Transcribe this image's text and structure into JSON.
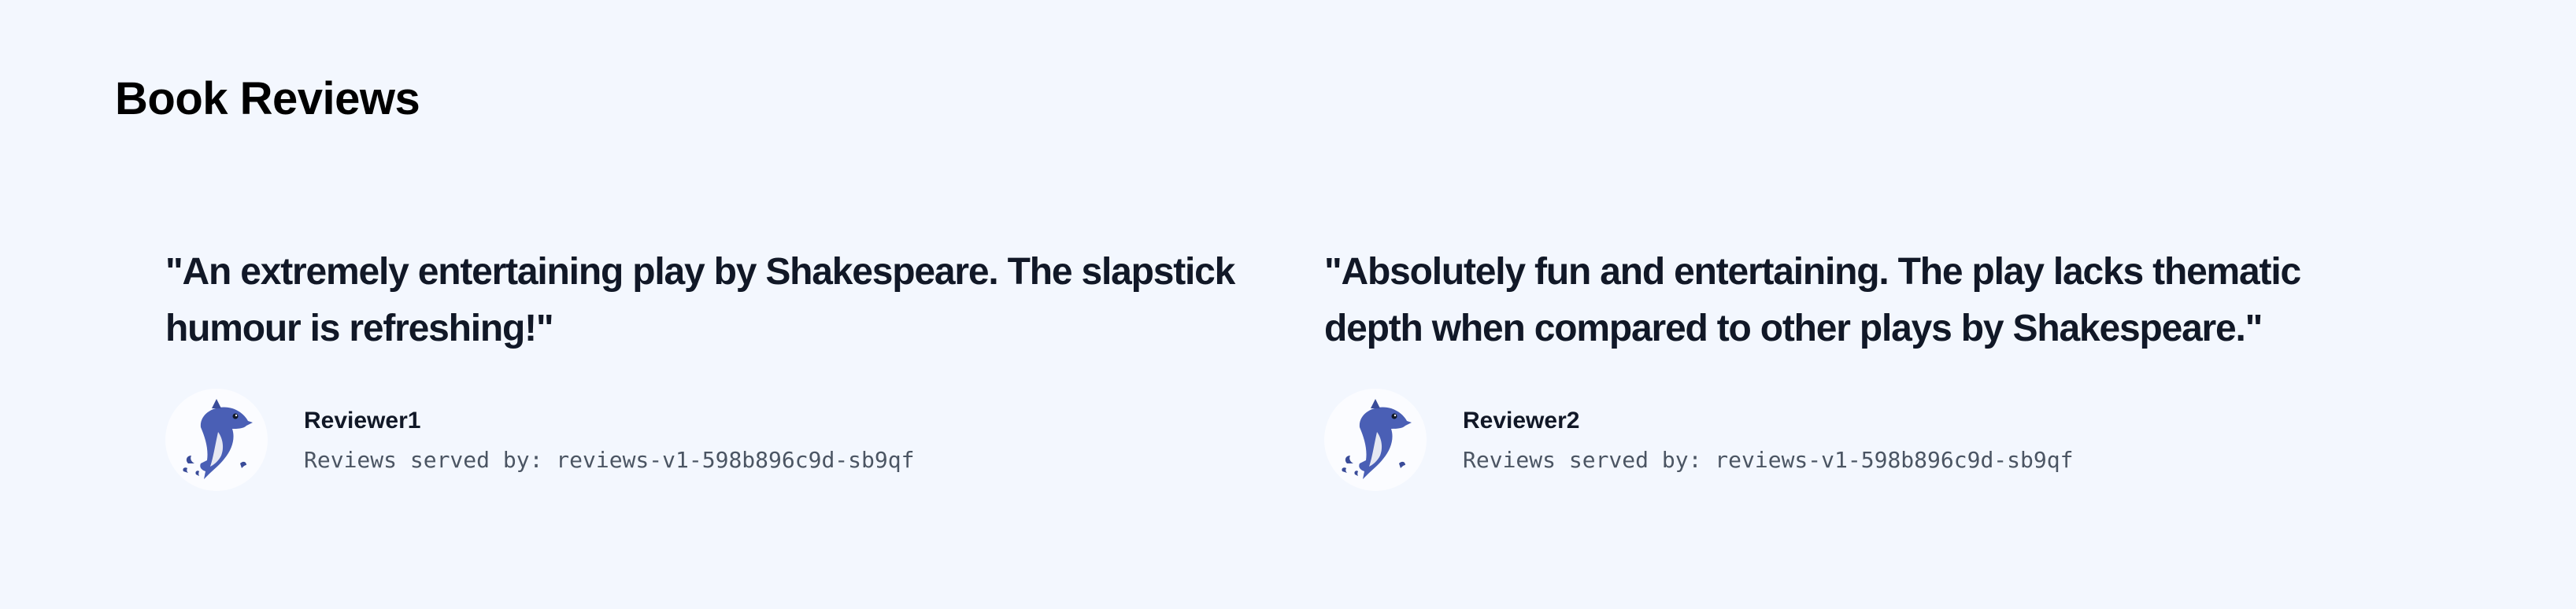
{
  "page": {
    "title": "Book Reviews"
  },
  "reviews": [
    {
      "text": "\"An extremely entertaining play by Shakespeare. The slapstick humour is refreshing!\"",
      "reviewer": "Reviewer1",
      "avatar_icon": "dolphin-icon",
      "served_by": "Reviews served by: reviews-v1-598b896c9d-sb9qf"
    },
    {
      "text": "\"Absolutely fun and entertaining. The play lacks thematic depth when compared to other plays by Shakespeare.\"",
      "reviewer": "Reviewer2",
      "avatar_icon": "dolphin-icon",
      "served_by": "Reviews served by: reviews-v1-598b896c9d-sb9qf"
    }
  ],
  "colors": {
    "background": "#f3f7fe",
    "text_primary": "#111827",
    "text_secondary": "#4b5563",
    "dolphin_blue": "#4a5fb5"
  }
}
